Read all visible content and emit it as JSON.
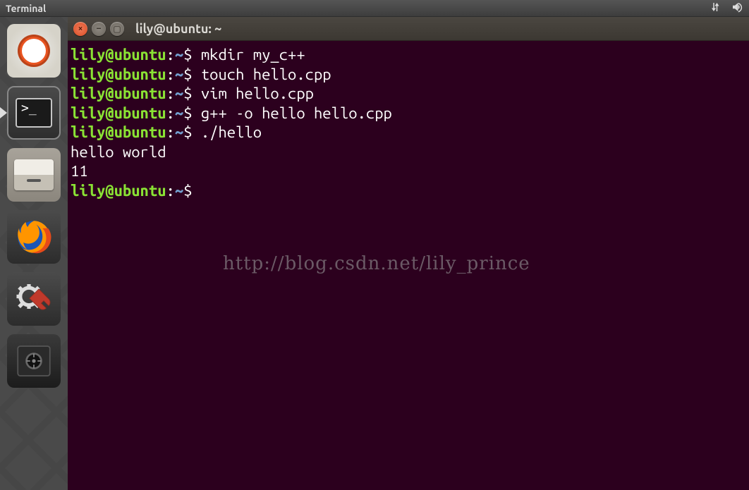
{
  "top_panel": {
    "title": "Terminal"
  },
  "launcher": {
    "items": [
      {
        "name": "dash-home",
        "label": "Dash"
      },
      {
        "name": "terminal",
        "label": "Terminal",
        "active": true
      },
      {
        "name": "files",
        "label": "Files"
      },
      {
        "name": "firefox",
        "label": "Firefox"
      },
      {
        "name": "system-settings",
        "label": "System Settings"
      },
      {
        "name": "backup",
        "label": "Backup"
      }
    ]
  },
  "window": {
    "title": "lily@ubuntu: ~",
    "close_tip": "Close",
    "min_tip": "Minimize",
    "max_tip": "Maximize"
  },
  "prompt": {
    "user_host": "lily@ubuntu",
    "path": "~",
    "symbol": "$"
  },
  "lines": [
    {
      "type": "cmd",
      "text": "mkdir my_c++"
    },
    {
      "type": "cmd",
      "text": "touch hello.cpp"
    },
    {
      "type": "cmd",
      "text": "vim hello.cpp"
    },
    {
      "type": "cmd",
      "text": "g++ -o hello hello.cpp"
    },
    {
      "type": "cmd",
      "text": "./hello"
    },
    {
      "type": "out",
      "text": "hello world"
    },
    {
      "type": "out",
      "text": "11"
    },
    {
      "type": "cmd",
      "text": ""
    }
  ],
  "watermark": "http://blog.csdn.net/lily_prince"
}
